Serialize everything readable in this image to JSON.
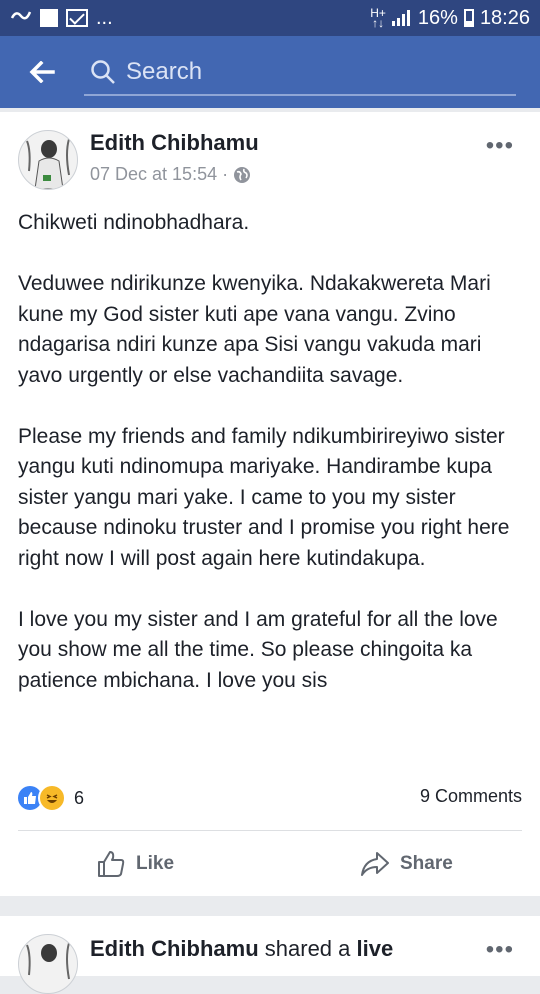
{
  "status_bar": {
    "more_dots": "...",
    "signal_label": "H+",
    "battery": "16%",
    "time": "18:26"
  },
  "app_bar": {
    "search_placeholder": "Search"
  },
  "post": {
    "author": "Edith Chibhamu",
    "timestamp": "07 Dec at 15:54",
    "separator": "·",
    "more": "•••",
    "paragraphs": [
      "Chikweti ndinobhadhara.",
      "Veduwee ndirikunze kwenyika. Ndakakwereta Mari kune my God sister kuti ape vana vangu. Zvino ndagarisa ndiri kunze apa Sisi vangu vakuda mari yavo urgently or else vachandiita savage.",
      "Please my friends and family ndikumbirireyiwo sister yangu kuti ndinomupa mariyake. Handirambe kupa sister yangu mari yake.  I came to you my sister because ndinoku truster and I promise you right here right now I will post again here kutindakupa.",
      "I love you my sister and I am grateful for all the love you show me all the time. So please chingoita ka patience mbichana. I love you sis"
    ],
    "reaction_count": "6",
    "comments": "9 Comments",
    "actions": {
      "like": "Like",
      "share": "Share"
    }
  },
  "next_post": {
    "author": "Edith Chibhamu",
    "shared_text": " shared a ",
    "shared_type": "live",
    "more": "•••"
  }
}
